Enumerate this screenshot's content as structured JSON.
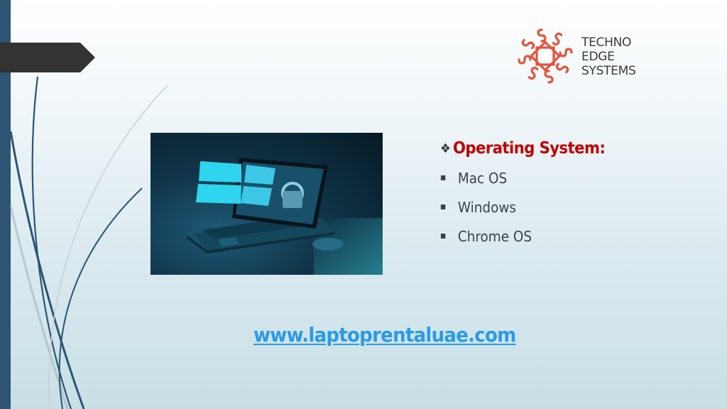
{
  "logo": {
    "lines": [
      "TECHNO",
      "EDGE",
      "SYSTEMS"
    ],
    "accent_color": "#e2553d"
  },
  "photo": {
    "description": "Laptop with Windows logo and padlock on screen, with mouse"
  },
  "content": {
    "heading_icon": "diamond-bullet-icon",
    "heading": "Operating System:",
    "heading_color": "#c00000",
    "items": [
      "Mac OS",
      "Windows",
      "Chrome OS"
    ]
  },
  "footer": {
    "url": "www.laptoprentaluae.com",
    "url_color": "#2a9be6"
  }
}
